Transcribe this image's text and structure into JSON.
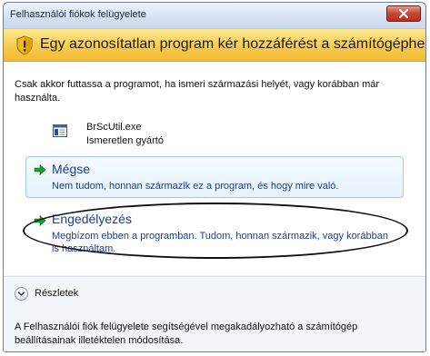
{
  "window": {
    "title": "Felhasználói fiókok felügyelete"
  },
  "banner": {
    "text": "Egy azonosítatlan program kér hozzáférést a számítógéphez",
    "color": "#f6c94b"
  },
  "description": "Csak akkor futtassa a programot, ha ismeri származási helyét, vagy korábban már használta.",
  "program": {
    "name": "BrScUtil.exe",
    "publisher": "Ismeretlen gyártó",
    "icon": "executable-icon"
  },
  "options": {
    "cancel": {
      "title": "Mégse",
      "description": "Nem tudom, honnan származik ez a program, és hogy mire való.",
      "icon": "green-arrow-icon"
    },
    "allow": {
      "title": "Engedélyezés",
      "description": "Megbízom ebben a programban. Tudom, honnan származik, vagy korábban is használtam.",
      "icon": "green-arrow-icon"
    }
  },
  "details": {
    "label": "Részletek",
    "icon": "chevron-down-icon"
  },
  "footer": {
    "text": "A Felhasználói fiók felügyelete segítségével megakadályozható a számítógép beállításainak illetéktelen módosítása."
  },
  "colors": {
    "link": "#1c3e8c",
    "arrow": "#1f9e2e",
    "close": "#c74432"
  }
}
